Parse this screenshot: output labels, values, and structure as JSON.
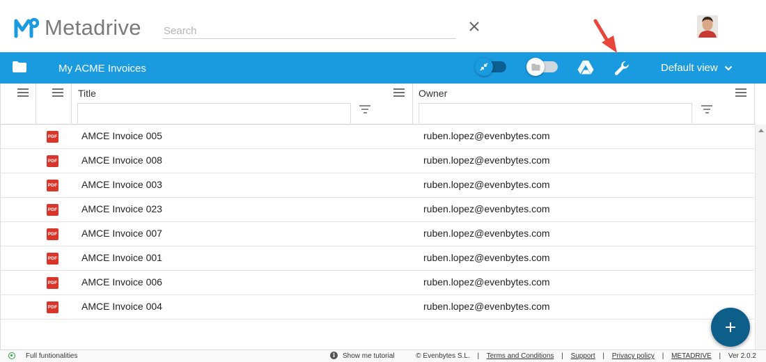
{
  "app": {
    "name": "Metadrive"
  },
  "search": {
    "placeholder": "Search"
  },
  "toolbar": {
    "folder_title": "My ACME Invoices",
    "view_label": "Default view"
  },
  "grid": {
    "columns": [
      {
        "label": "Title",
        "filter_placeholder": ""
      },
      {
        "label": "Owner",
        "filter_placeholder": ""
      }
    ],
    "rows": [
      {
        "type_icon": "PDF",
        "title": "AMCE Invoice 005",
        "owner": "ruben.lopez@evenbytes.com"
      },
      {
        "type_icon": "PDF",
        "title": "AMCE Invoice 008",
        "owner": "ruben.lopez@evenbytes.com"
      },
      {
        "type_icon": "PDF",
        "title": "AMCE Invoice 003",
        "owner": "ruben.lopez@evenbytes.com"
      },
      {
        "type_icon": "PDF",
        "title": "AMCE Invoice 023",
        "owner": "ruben.lopez@evenbytes.com"
      },
      {
        "type_icon": "PDF",
        "title": "AMCE Invoice 007",
        "owner": "ruben.lopez@evenbytes.com"
      },
      {
        "type_icon": "PDF",
        "title": "AMCE Invoice 001",
        "owner": "ruben.lopez@evenbytes.com"
      },
      {
        "type_icon": "PDF",
        "title": "AMCE Invoice 006",
        "owner": "ruben.lopez@evenbytes.com"
      },
      {
        "type_icon": "PDF",
        "title": "AMCE Invoice 004",
        "owner": "ruben.lopez@evenbytes.com"
      }
    ]
  },
  "footer": {
    "status": "Full funtionalities",
    "tutorial": "Show me tutorial",
    "copyright": "© Evenbytes S.L.",
    "terms": "Terms and Conditions",
    "support": "Support",
    "privacy": "Privacy policy",
    "brand_link": "METADRIVE",
    "version": "Ver 2.0.2"
  },
  "colors": {
    "toolbar_bg": "#1a9be0",
    "fab_bg": "#0e5e8a",
    "pdf_icon": "#d9362b",
    "status_ok": "#27a545",
    "annotation_arrow": "#e8463a"
  },
  "icons": [
    "metadrive-logo-icon",
    "close-icon",
    "avatar",
    "folder-icon",
    "sync-toggle",
    "folder-toggle",
    "google-drive-icon",
    "wrench-icon",
    "chevron-down-icon",
    "column-menu-icon",
    "filter-icon",
    "pdf-icon",
    "plus-icon",
    "status-dot-icon",
    "info-icon"
  ]
}
